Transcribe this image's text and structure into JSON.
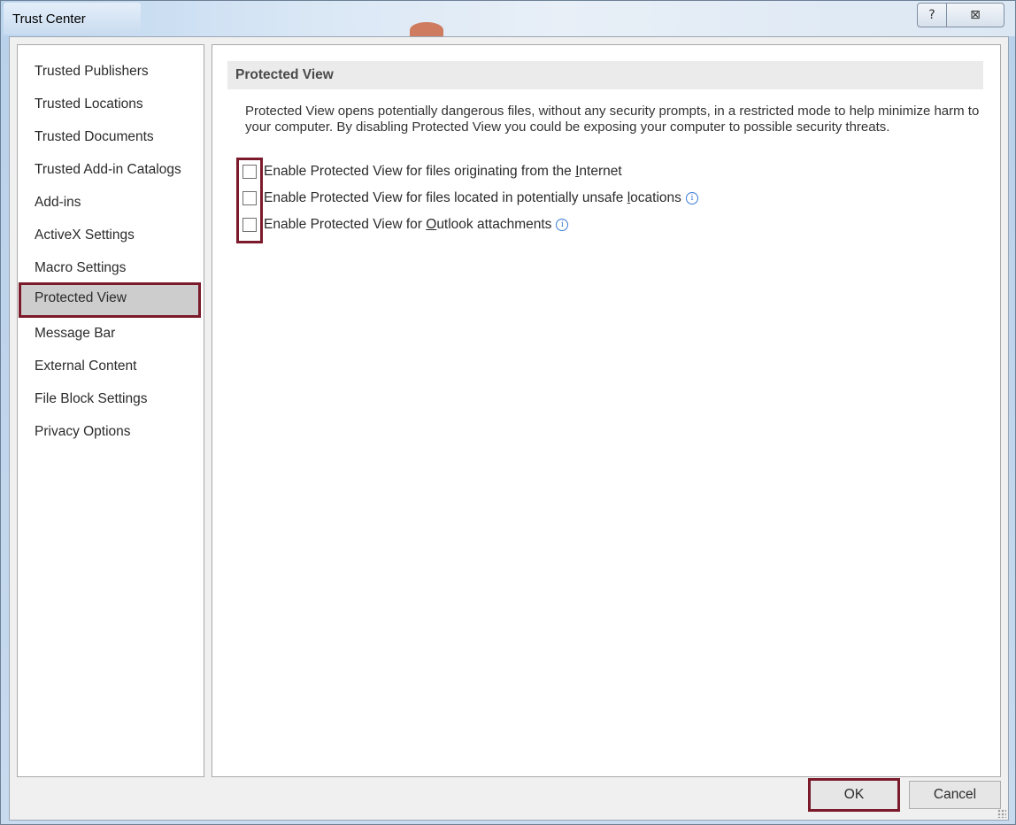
{
  "window": {
    "title": "Trust Center",
    "help_glyph": "?",
    "close_glyph": "⊠"
  },
  "sidebar": {
    "items": [
      {
        "label": "Trusted Publishers",
        "selected": false
      },
      {
        "label": "Trusted Locations",
        "selected": false
      },
      {
        "label": "Trusted Documents",
        "selected": false
      },
      {
        "label": "Trusted Add-in Catalogs",
        "selected": false
      },
      {
        "label": "Add-ins",
        "selected": false
      },
      {
        "label": "ActiveX Settings",
        "selected": false
      },
      {
        "label": "Macro Settings",
        "selected": false
      },
      {
        "label": "Protected View",
        "selected": true
      },
      {
        "label": "Message Bar",
        "selected": false
      },
      {
        "label": "External Content",
        "selected": false
      },
      {
        "label": "File Block Settings",
        "selected": false
      },
      {
        "label": "Privacy Options",
        "selected": false
      }
    ]
  },
  "main": {
    "section_title": "Protected View",
    "description": "Protected View opens potentially dangerous files, without any security prompts, in a restricted mode to help minimize harm to your computer. By disabling Protected View you could be exposing your computer to possible security threats.",
    "options": [
      {
        "prefix": "Enable Protected View for files originating from the ",
        "accel": "I",
        "suffix": "nternet",
        "checked": false,
        "info": false
      },
      {
        "prefix": "Enable Protected View for files located in potentially unsafe ",
        "accel": "l",
        "suffix": "ocations",
        "checked": false,
        "info": true
      },
      {
        "prefix": "Enable Protected View for ",
        "accel": "O",
        "suffix": "utlook attachments",
        "checked": false,
        "info": true
      }
    ],
    "info_glyph": "i"
  },
  "footer": {
    "ok_label": "OK",
    "cancel_label": "Cancel"
  },
  "colors": {
    "highlight": "#7b1a2a",
    "info": "#3a7bd5"
  }
}
